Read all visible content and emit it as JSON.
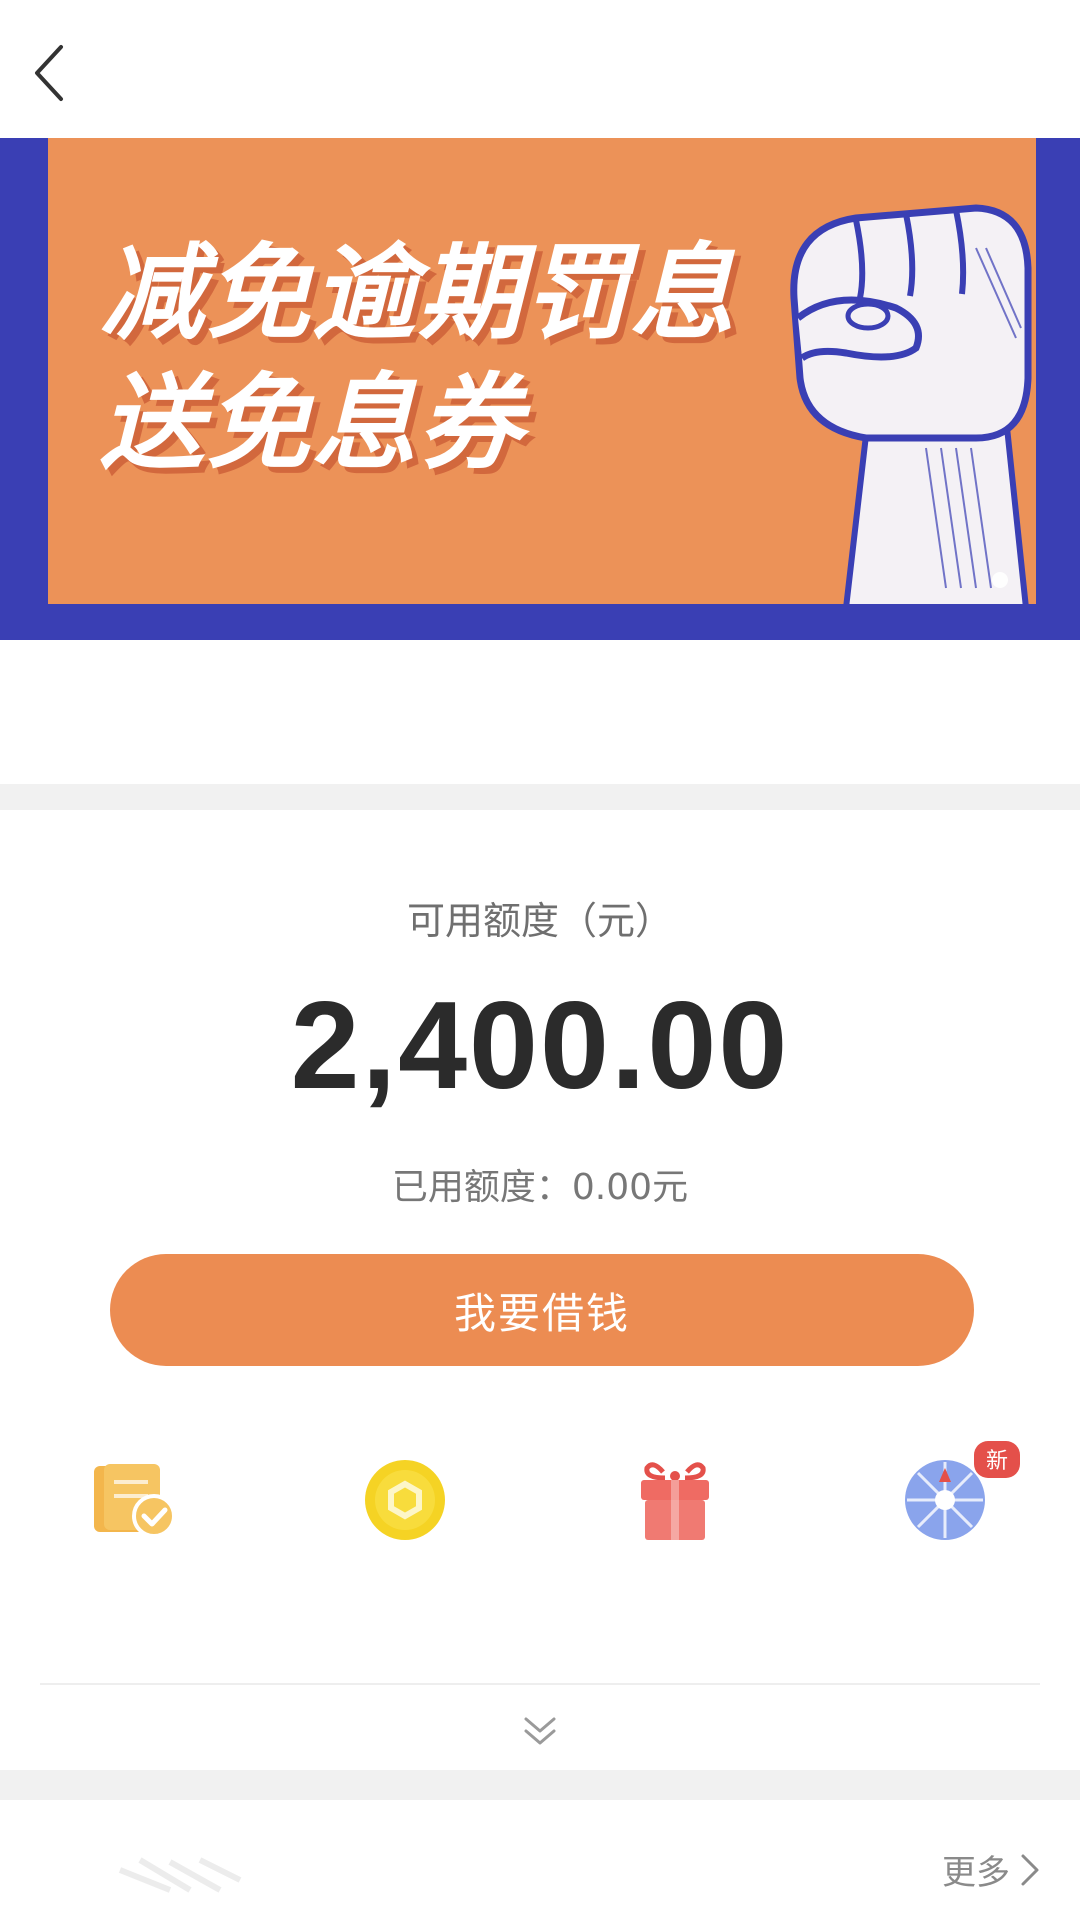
{
  "banner": {
    "line1": "减免逾期罚息",
    "line2": "送免息券"
  },
  "credit": {
    "available_label": "可用额度（元）",
    "amount": "2,400.00",
    "used_label": "已用额度：0.00元"
  },
  "borrow_button": "我要借钱",
  "quick_actions": [
    {
      "icon": "bill-check-icon"
    },
    {
      "icon": "coin-icon"
    },
    {
      "icon": "gift-icon"
    },
    {
      "icon": "lucky-wheel-icon",
      "badge": "新"
    }
  ],
  "more_link": "更多",
  "colors": {
    "banner_bg": "#ec9258",
    "banner_border": "#3a3fb4",
    "accent": "#ec8c52",
    "badge": "#e4504a"
  }
}
